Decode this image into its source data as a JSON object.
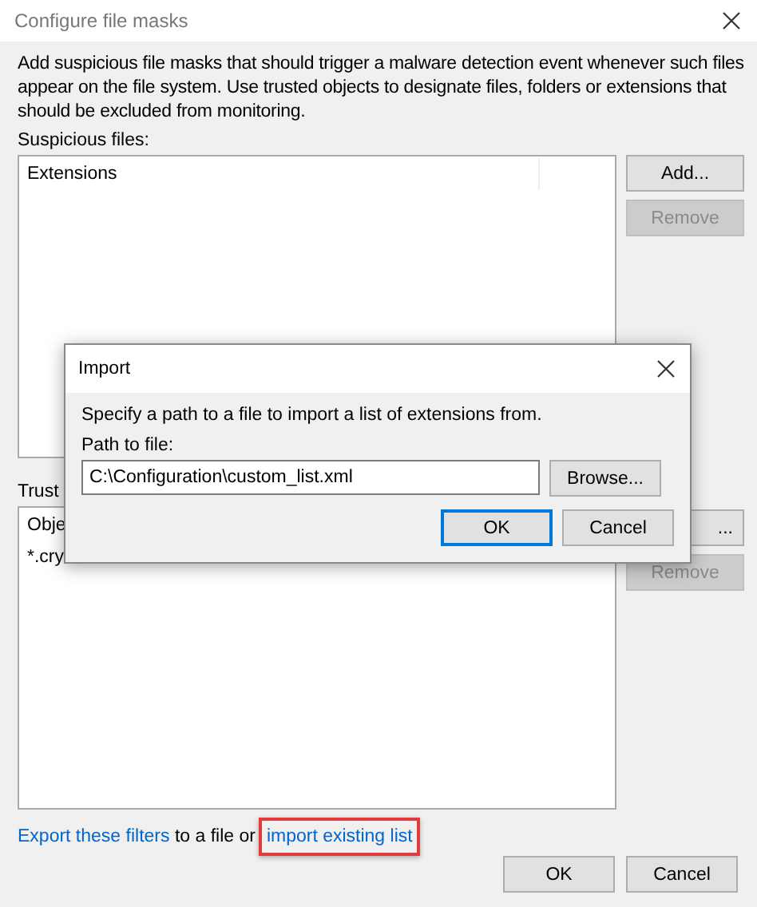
{
  "window": {
    "title": "Configure file masks"
  },
  "description": "Add suspicious file masks that should trigger a malware detection event whenever such files appear on the file system. Use trusted objects to designate files, folders or extensions that should be excluded from monitoring.",
  "suspicious": {
    "label": "Suspicious files:",
    "column_header": "Extensions",
    "buttons": [
      {
        "label": "Add...",
        "disabled": false
      },
      {
        "label": "Remove",
        "disabled": true
      }
    ]
  },
  "trusted": {
    "label": "Trust",
    "column_header": "Obje",
    "items": [
      "*.cry"
    ],
    "buttons": [
      {
        "label": "...",
        "disabled": false
      },
      {
        "label": "Remove",
        "disabled": true
      }
    ]
  },
  "footer": {
    "export_link": "Export these filters",
    "middle": "to a file or",
    "import_link": "import existing list",
    "import_highlighted": true
  },
  "buttons": [
    {
      "label": "OK"
    },
    {
      "label": "Cancel"
    }
  ],
  "dialog": {
    "title": "Import",
    "message": "Specify a path to a file to import a list of extensions from.",
    "path_label": "Path to file:",
    "path_value": "C:\\Configuration\\custom_list.xml",
    "buttons": [
      {
        "kind": "browse",
        "label": "Browse...",
        "focused": false
      },
      {
        "kind": "ok",
        "label": "OK",
        "focused": true
      },
      {
        "kind": "cancel",
        "label": "Cancel",
        "focused": false
      }
    ]
  }
}
